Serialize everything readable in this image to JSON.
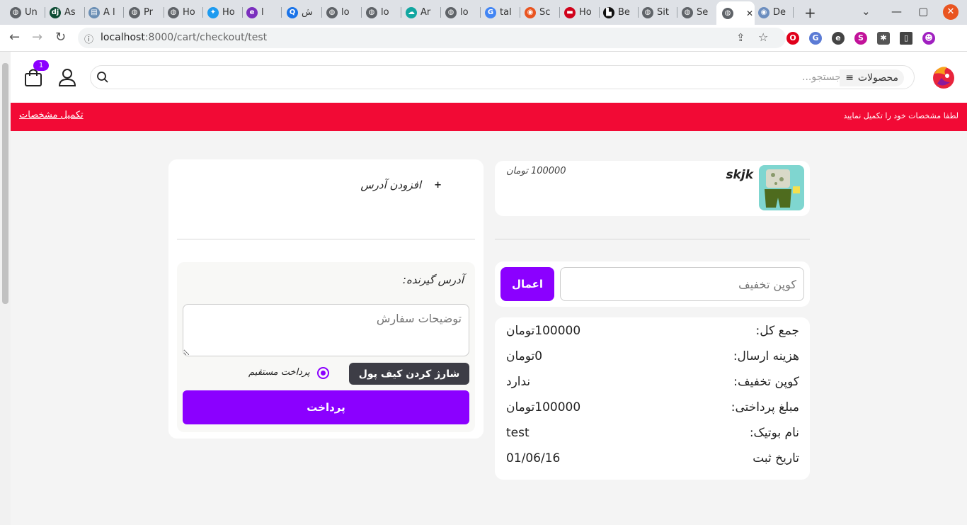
{
  "browser": {
    "tabs": [
      {
        "label": "Un",
        "icon": "globe-icon"
      },
      {
        "label": "As",
        "icon": "django-icon"
      },
      {
        "label": "A l",
        "icon": "dbdiagram-icon"
      },
      {
        "label": "Pr",
        "icon": "globe-icon"
      },
      {
        "label": "Ho",
        "icon": "globe-icon"
      },
      {
        "label": "Ho",
        "icon": "bird-icon"
      },
      {
        "label": "ا",
        "icon": "e-icon"
      },
      {
        "label": "ش",
        "icon": "q-icon"
      },
      {
        "label": "lo",
        "icon": "globe-icon"
      },
      {
        "label": "lo",
        "icon": "globe-icon"
      },
      {
        "label": "Ar",
        "icon": "cloud-icon"
      },
      {
        "label": "lo",
        "icon": "globe-icon"
      },
      {
        "label": "tal",
        "icon": "google-icon"
      },
      {
        "label": "Sc",
        "icon": "ubuntu-icon"
      },
      {
        "label": "Ho",
        "icon": "flag-icon"
      },
      {
        "label": "Be",
        "icon": "be-icon"
      },
      {
        "label": "Sit",
        "icon": "globe-icon"
      },
      {
        "label": "Se",
        "icon": "globe-icon"
      },
      {
        "label": "",
        "icon": "globe-icon"
      },
      {
        "label": "De",
        "icon": "eye-icon"
      }
    ],
    "url_host": "localhost",
    "url_path": ":8000/cart/checkout/test"
  },
  "header": {
    "search_placeholder": "جستجو...",
    "products_label": "محصولات",
    "cart_count": "1"
  },
  "alert": {
    "message": "لطفا مشخصات خود را تکمیل نمایید",
    "link": "تکمیل مشخصات"
  },
  "cart_item": {
    "name": "skjk",
    "price": "100000 تومان"
  },
  "coupon": {
    "placeholder": "کوپن تخفیف",
    "apply_label": "اعمال"
  },
  "summary": [
    {
      "key": "جمع کل:",
      "value": "100000تومان"
    },
    {
      "key": "هزینه ارسال:",
      "value": "0تومان"
    },
    {
      "key": "کوپن تخفیف:",
      "value": "ندارد"
    },
    {
      "key": "مبلغ پرداختی:",
      "value": "100000تومان"
    },
    {
      "key": "نام بوتیک:",
      "value": "test"
    },
    {
      "key": "تاریخ ثبت",
      "value": "01/06/16"
    }
  ],
  "address": {
    "add_label": "افزودن آدرس",
    "recipient_label": "آدرس گیرنده:",
    "notes_placeholder": "توضیحات سفارش",
    "direct_payment_label": "پرداخت مستقیم",
    "wallet_button": "شارژ کردن کیف پول",
    "pay_button": "پرداخت"
  },
  "colors": {
    "accent": "#8b00ff",
    "alert": "#f20a35"
  }
}
